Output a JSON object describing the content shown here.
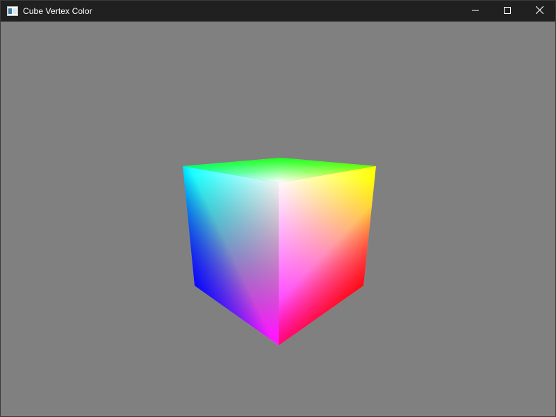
{
  "window": {
    "title": "Cube Vertex Color",
    "icon": "app-window-icon",
    "controls": {
      "minimize": "minimize-icon",
      "maximize": "maximize-icon",
      "close": "close-icon"
    }
  },
  "viewport": {
    "background": "#808080",
    "content": "rgb-vertex-colored-cube"
  },
  "cube": {
    "vertex_colors": {
      "top_left": "#00ffff",
      "top_back": "#00ff00",
      "top_right": "#ffff00",
      "top_front": "#ffffff",
      "bottom_left": "#0000ff",
      "bottom_front": "#ff00ff",
      "bottom_right": "#ff0000"
    }
  }
}
